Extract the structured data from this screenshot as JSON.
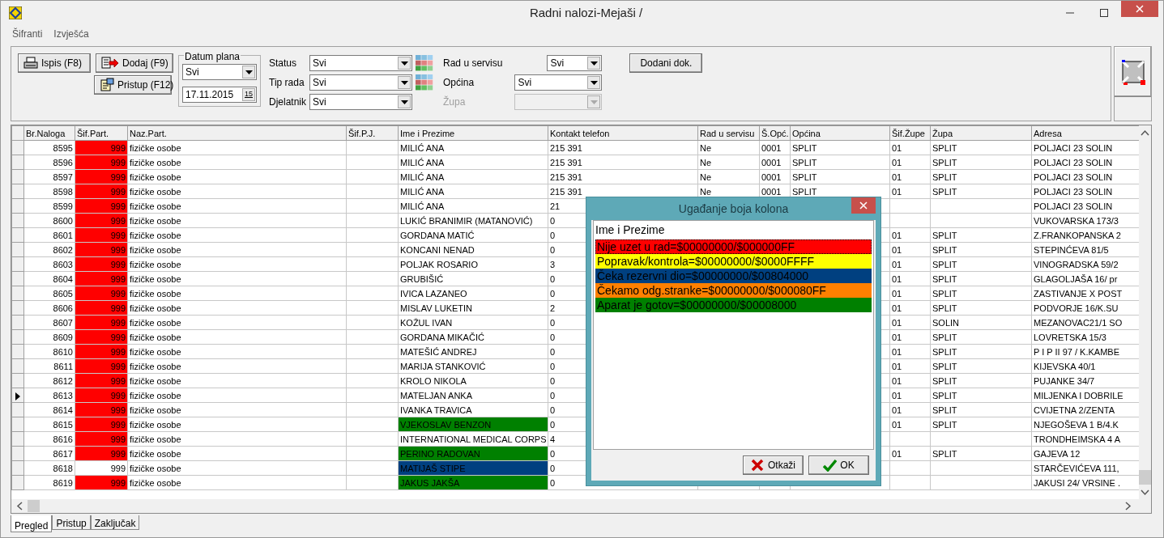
{
  "window": {
    "title": "Radni nalozi-Mejaši /"
  },
  "menu": [
    "Šifranti",
    "Izvješća"
  ],
  "toolbar": {
    "buttons": [
      {
        "label": "Ispis (F8)",
        "kind": "print"
      },
      {
        "label": "Dodaj (F9)",
        "kind": "add"
      },
      {
        "label": "Pristup (F12)",
        "kind": "access"
      }
    ],
    "date_plan": {
      "legend": "Datum plana",
      "period": "Svi",
      "date": "17.11.2015",
      "calendar_label": "15"
    },
    "filters": [
      {
        "label": "Status",
        "value": "Svi",
        "disabled": false
      },
      {
        "label": "Tip rada",
        "value": "Svi",
        "disabled": false
      },
      {
        "label": "Djelatnik",
        "value": "Svi",
        "disabled": false
      }
    ],
    "filters_right": [
      {
        "label": "Rad u servisu",
        "value": "Svi",
        "disabled": false
      },
      {
        "label": "Općina",
        "value": "Svi",
        "disabled": false
      },
      {
        "label": "Župa",
        "disabled": true
      }
    ],
    "extra_button": "Dodani dok."
  },
  "table": {
    "columns": [
      "Br.Naloga",
      "Šif.Part.",
      "Naz.Part.",
      "Šif.P.J.",
      "Ime i Prezime",
      "Kontakt telefon",
      "Rad u servisu",
      "Š.Opć.",
      "Općina",
      "Šif.Župe",
      "Župa",
      "Adresa"
    ],
    "rows": [
      {
        "selected": false,
        "sif_part_marked": true,
        "cells": [
          "8595",
          "999",
          "fizičke osobe",
          null,
          "MILIĆ ANA",
          "215 391",
          "Ne",
          "0001",
          "SPLIT",
          "01",
          "SPLIT",
          "POLJACI 23 SOLIN"
        ]
      },
      {
        "selected": false,
        "sif_part_marked": true,
        "cells": [
          "8596",
          "999",
          "fizičke osobe",
          null,
          "MILIĆ ANA",
          "215 391",
          "Ne",
          "0001",
          "SPLIT",
          "01",
          "SPLIT",
          "POLJACI 23 SOLIN"
        ]
      },
      {
        "selected": false,
        "sif_part_marked": true,
        "cells": [
          "8597",
          "999",
          "fizičke osobe",
          null,
          "MILIĆ ANA",
          "215 391",
          "Ne",
          "0001",
          "SPLIT",
          "01",
          "SPLIT",
          "POLJACI 23 SOLIN"
        ]
      },
      {
        "selected": false,
        "sif_part_marked": true,
        "cells": [
          "8598",
          "999",
          "fizičke osobe",
          null,
          "MILIĆ ANA",
          "215 391",
          "Ne",
          "0001",
          "SPLIT",
          "01",
          "SPLIT",
          "POLJACI 23 SOLIN"
        ]
      },
      {
        "selected": false,
        "sif_part_marked": true,
        "cells": [
          "8599",
          "999",
          "fizičke osobe",
          null,
          "MILIĆ ANA",
          "21",
          null,
          null,
          null,
          null,
          null,
          "POLJACI 23 SOLIN"
        ]
      },
      {
        "selected": false,
        "sif_part_marked": true,
        "cells": [
          "8600",
          "999",
          "fizičke osobe",
          null,
          "LUKIĆ BRANIMIR (MATANOVIĆ)",
          "0",
          null,
          null,
          null,
          null,
          null,
          "VUKOVARSKA 173/3"
        ]
      },
      {
        "selected": false,
        "sif_part_marked": true,
        "cells": [
          "8601",
          "999",
          "fizičke osobe",
          null,
          "GORDANA MATIĆ",
          "0",
          null,
          null,
          null,
          "01",
          "SPLIT",
          "Z.FRANKOPANSKA 2"
        ]
      },
      {
        "selected": false,
        "sif_part_marked": true,
        "cells": [
          "8602",
          "999",
          "fizičke osobe",
          null,
          "KONCANI NENAD",
          "0",
          null,
          null,
          null,
          "01",
          "SPLIT",
          "STEPINĆEVA 81/5"
        ]
      },
      {
        "selected": false,
        "sif_part_marked": true,
        "cells": [
          "8603",
          "999",
          "fizičke osobe",
          null,
          "POLJAK ROSARIO",
          "3",
          null,
          null,
          null,
          "01",
          "SPLIT",
          "VINOGRADSKA 59/2"
        ]
      },
      {
        "selected": false,
        "sif_part_marked": true,
        "cells": [
          "8604",
          "999",
          "fizičke osobe",
          null,
          "GRUBIŠIĆ",
          "0",
          null,
          null,
          null,
          "01",
          "SPLIT",
          "GLAGOLJAŠA 16/ pr"
        ]
      },
      {
        "selected": false,
        "sif_part_marked": true,
        "cells": [
          "8605",
          "999",
          "fizičke osobe",
          null,
          "IVICA LAZANEO",
          "0",
          null,
          null,
          null,
          "01",
          "SPLIT",
          "ZASTIVANJE X POST"
        ]
      },
      {
        "selected": false,
        "sif_part_marked": true,
        "cells": [
          "8606",
          "999",
          "fizičke osobe",
          null,
          "MISLAV LUKETIN",
          "2",
          null,
          null,
          null,
          "01",
          "SPLIT",
          "PODVORJE 16/K.SU"
        ]
      },
      {
        "selected": false,
        "sif_part_marked": true,
        "cells": [
          "8607",
          "999",
          "fizičke osobe",
          null,
          "KOŽUL IVAN",
          "0",
          null,
          null,
          null,
          "01",
          "SOLIN",
          "MEZANOVAC21/1 SO"
        ]
      },
      {
        "selected": false,
        "sif_part_marked": true,
        "cells": [
          "8609",
          "999",
          "fizičke osobe",
          null,
          "GORDANA MIKAČIĆ",
          "0",
          null,
          null,
          null,
          "01",
          "SPLIT",
          "LOVRETSKA 15/3"
        ]
      },
      {
        "selected": false,
        "sif_part_marked": true,
        "cells": [
          "8610",
          "999",
          "fizičke osobe",
          null,
          "MATEŠIĆ ANDREJ",
          "0",
          null,
          null,
          null,
          "01",
          "SPLIT",
          "P I P II  97 / K.KAMBE"
        ]
      },
      {
        "selected": false,
        "sif_part_marked": true,
        "cells": [
          "8611",
          "999",
          "fizičke osobe",
          null,
          "MARIJA STANKOVIĆ",
          "0",
          null,
          null,
          null,
          "01",
          "SPLIT",
          "KIJEVSKA 40/1"
        ]
      },
      {
        "selected": false,
        "sif_part_marked": true,
        "cells": [
          "8612",
          "999",
          "fizičke osobe",
          null,
          "KROLO NIKOLA",
          "0",
          null,
          null,
          null,
          "01",
          "SPLIT",
          "PUJANKE 34/7"
        ]
      },
      {
        "selected": true,
        "sif_part_marked": true,
        "cells": [
          "8613",
          "999",
          "fizičke osobe",
          null,
          "MATELJAN ANKA",
          "0",
          null,
          null,
          null,
          "01",
          "SPLIT",
          "MILJENKA I DOBRILE"
        ]
      },
      {
        "selected": false,
        "sif_part_marked": true,
        "cells": [
          "8614",
          "999",
          "fizičke osobe",
          null,
          "IVANKA TRAVICA",
          "0",
          null,
          null,
          null,
          "01",
          "SPLIT",
          "CVIJETNA 2/ZENTA"
        ]
      },
      {
        "selected": false,
        "sif_part_marked": true,
        "color": "#008000",
        "cells": [
          "8615",
          "999",
          "fizičke osobe",
          null,
          "VJEKOSLAV BENZON",
          "0",
          null,
          null,
          null,
          "01",
          "SPLIT",
          "NJEGOŠEVA 1 B/4.K"
        ]
      },
      {
        "selected": false,
        "sif_part_marked": true,
        "cells": [
          "8616",
          "999",
          "fizičke osobe",
          null,
          "INTERNATIONAL MEDICAL CORPS",
          "4",
          null,
          null,
          null,
          null,
          null,
          "TRONDHEIMSKA 4 A"
        ]
      },
      {
        "selected": false,
        "sif_part_marked": true,
        "color": "#008000",
        "cells": [
          "8617",
          "999",
          "fizičke osobe",
          null,
          "PERINO RADOVAN",
          "0",
          null,
          null,
          null,
          "01",
          "SPLIT",
          "GAJEVA 12"
        ]
      },
      {
        "selected": false,
        "sif_part_marked": false,
        "color": "#004080",
        "cells": [
          "8618",
          "999",
          "fizičke osobe",
          null,
          "MATIJAŠ STIPE",
          "0",
          null,
          null,
          null,
          null,
          null,
          "STARČEVIĆEVA 111,"
        ]
      },
      {
        "selected": false,
        "sif_part_marked": true,
        "color": "#008000",
        "cells": [
          "8619",
          "999",
          "fizičke osobe",
          null,
          "JAKUS JAKŠA",
          "0",
          null,
          null,
          null,
          null,
          null,
          "JAKUSI 24/ VRSINE ."
        ]
      }
    ]
  },
  "tabs": [
    {
      "label": "Pregled",
      "selected": true
    },
    {
      "label": "Pristup",
      "selected": false
    },
    {
      "label": "Zaključak",
      "selected": false
    }
  ],
  "dialog": {
    "title": "Ugađanje boja kolona",
    "list_header": "Ime i Prezime",
    "items": [
      {
        "label": "Nije uzet u rad=$00000000/$000000FF",
        "color": "#ff0000",
        "selected": true
      },
      {
        "label": "Popravak/kontrola=$00000000/$0000FFFF",
        "color": "#ffff00",
        "selected": false
      },
      {
        "label": "Čeka rezervni dio=$00000000/$00804000",
        "color": "#004080",
        "selected": false
      },
      {
        "label": "Čekamo odg.stranke=$00000000/$000080FF",
        "color": "#ff8000",
        "selected": false
      },
      {
        "label": "Aparat je gotov=$00000000/$00008000",
        "color": "#008000",
        "selected": false
      }
    ],
    "buttons": [
      {
        "label": "Otkaži",
        "kind": "cancel"
      },
      {
        "label": "OK",
        "kind": "ok"
      }
    ]
  }
}
